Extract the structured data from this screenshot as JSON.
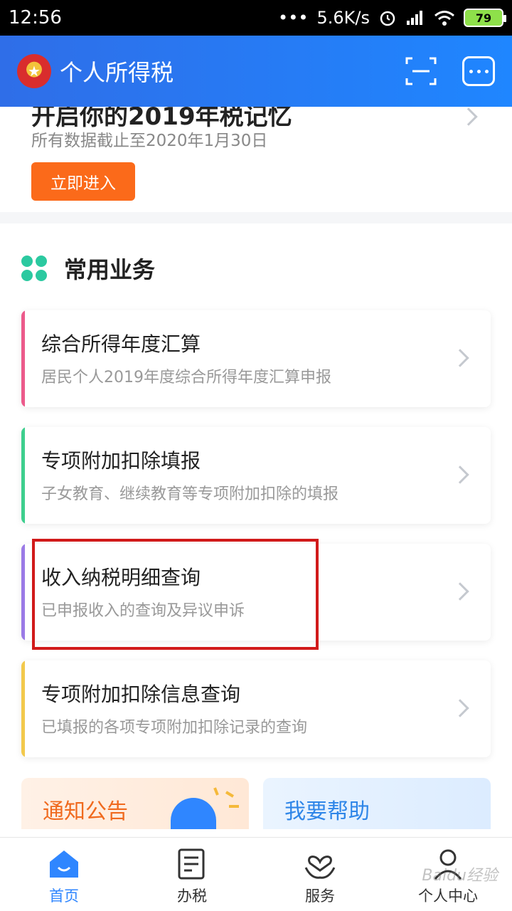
{
  "status_bar": {
    "time": "12:56",
    "dots": "•••",
    "net_speed": "5.6K/s",
    "battery": "79"
  },
  "header": {
    "title": "个人所得税"
  },
  "promo": {
    "partial_title": "开启你的2019年税记忆",
    "subtitle": "所有数据截止至2020年1月30日",
    "button": "立即进入"
  },
  "section": {
    "title": "常用业务"
  },
  "services": [
    {
      "title": "综合所得年度汇算",
      "subtitle": "居民个人2019年度综合所得年度汇算申报",
      "accent": "#ec5a8b"
    },
    {
      "title": "专项附加扣除填报",
      "subtitle": "子女教育、继续教育等专项附加扣除的填报",
      "accent": "#3ecf8e"
    },
    {
      "title": "收入纳税明细查询",
      "subtitle": "已申报收入的查询及异议申诉",
      "accent": "#9b7be6"
    },
    {
      "title": "专项附加扣除信息查询",
      "subtitle": "已填报的各项专项附加扣除记录的查询",
      "accent": "#f2c94c"
    }
  ],
  "tiles": {
    "notice": "通知公告",
    "help": "我要帮助"
  },
  "nav": [
    {
      "label": "首页",
      "icon": "home-icon"
    },
    {
      "label": "办税",
      "icon": "tax-form-icon"
    },
    {
      "label": "服务",
      "icon": "service-heart-icon"
    },
    {
      "label": "个人中心",
      "icon": "person-icon"
    }
  ],
  "colors": {
    "primary": "#2f86ff",
    "orange": "#fb6a1a",
    "highlight": "#d11a1a"
  },
  "watermark": "Baidu经验"
}
